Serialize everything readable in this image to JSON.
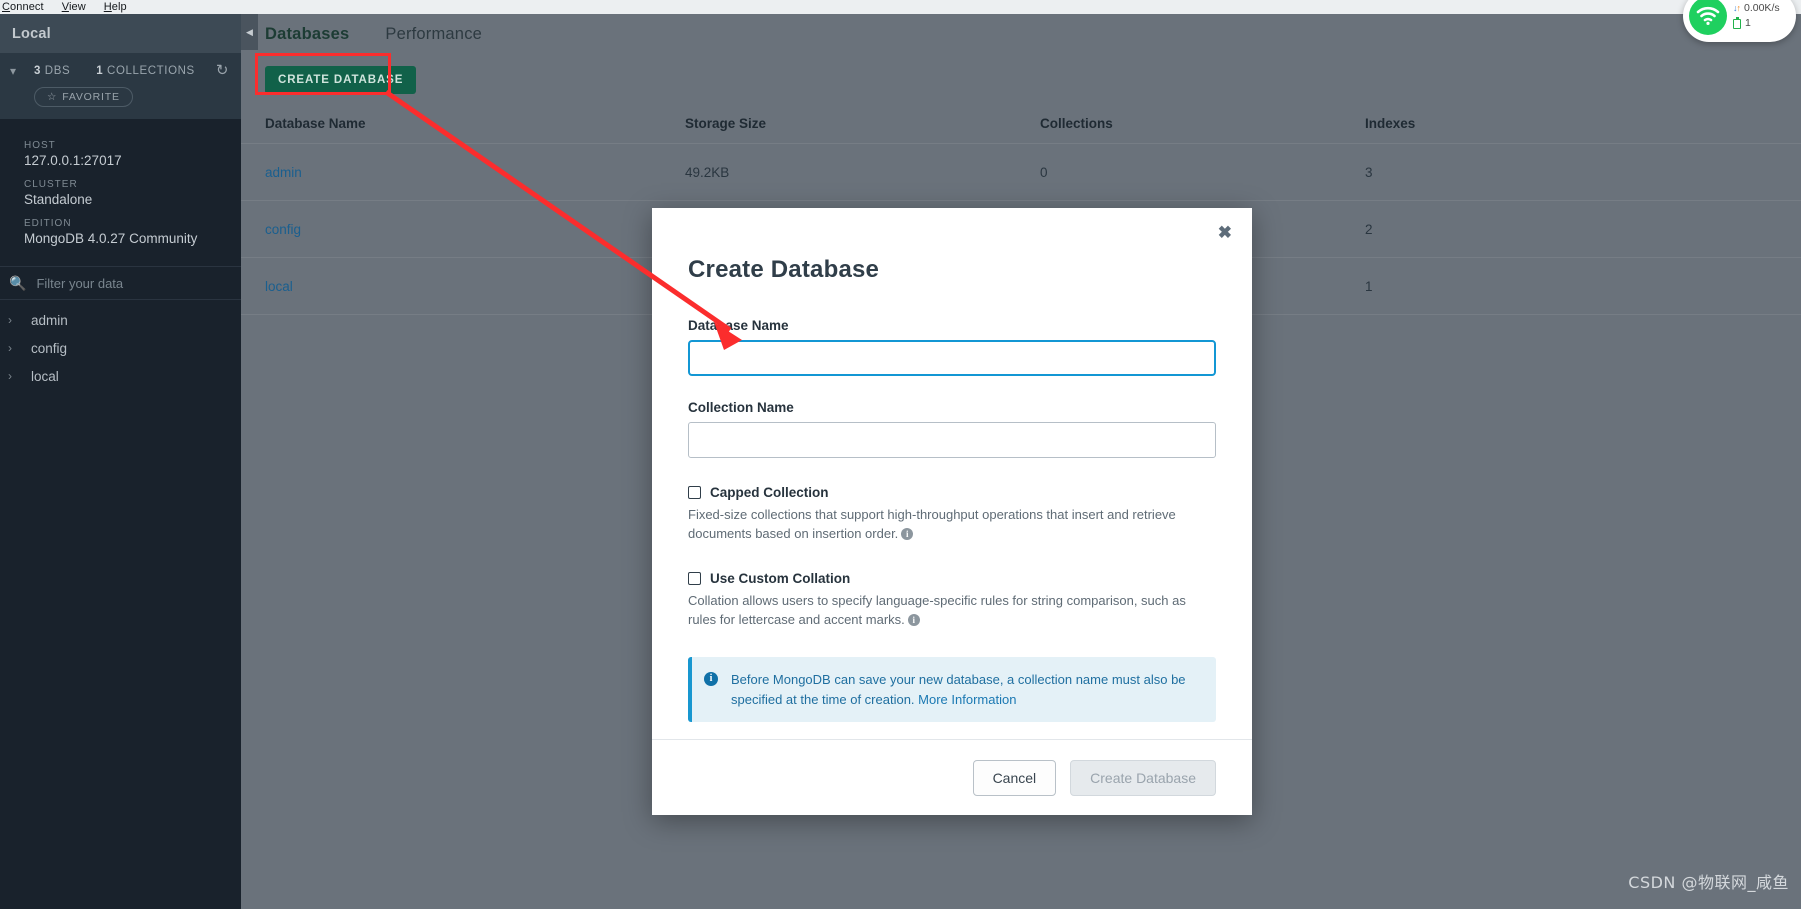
{
  "menubar": {
    "items": [
      {
        "label": "Connect",
        "accel": "C"
      },
      {
        "label": "View",
        "accel": "V"
      },
      {
        "label": "Help",
        "accel": "H"
      }
    ]
  },
  "sidebar": {
    "title": "Local",
    "stats": {
      "dbs_count": "3",
      "dbs_label": "DBS",
      "collections_count": "1",
      "collections_label": "COLLECTIONS"
    },
    "favorite_label": "FAVORITE",
    "info": [
      {
        "label": "HOST",
        "value": "127.0.0.1:27017"
      },
      {
        "label": "CLUSTER",
        "value": "Standalone"
      },
      {
        "label": "EDITION",
        "value": "MongoDB 4.0.27 Community"
      }
    ],
    "search": {
      "placeholder": "Filter your data",
      "value": ""
    },
    "tree": [
      {
        "label": "admin"
      },
      {
        "label": "config"
      },
      {
        "label": "local"
      }
    ]
  },
  "main": {
    "tabs": [
      {
        "label": "Databases",
        "active": true
      },
      {
        "label": "Performance",
        "active": false
      }
    ],
    "toolbar": {
      "create_database_label": "CREATE DATABASE"
    },
    "table": {
      "columns": [
        "Database Name",
        "Storage Size",
        "Collections",
        "Indexes"
      ],
      "rows": [
        {
          "name": "admin",
          "storage": "49.2KB",
          "collections": "0",
          "indexes": "3"
        },
        {
          "name": "config",
          "storage": "",
          "collections": "",
          "indexes": "2"
        },
        {
          "name": "local",
          "storage": "",
          "collections": "",
          "indexes": "1"
        }
      ]
    }
  },
  "modal": {
    "title": "Create Database",
    "close_label": "✖",
    "database_name": {
      "label": "Database Name",
      "value": "",
      "placeholder": ""
    },
    "collection_name": {
      "label": "Collection Name",
      "value": "",
      "placeholder": ""
    },
    "capped": {
      "label": "Capped Collection",
      "help": "Fixed-size collections that support high-throughput operations that insert and retrieve documents based on insertion order.",
      "checked": false
    },
    "collation": {
      "label": "Use Custom Collation",
      "help": "Collation allows users to specify language-specific rules for string comparison, such as rules for lettercase and accent marks.",
      "checked": false
    },
    "banner": {
      "text": "Before MongoDB can save your new database, a collection name must also be specified at the time of creation.",
      "link_label": "More Information"
    },
    "footer": {
      "cancel_label": "Cancel",
      "submit_label": "Create Database",
      "submit_disabled": true
    }
  },
  "network_widget": {
    "speed": "0.00K/s",
    "count": "1"
  },
  "watermark": "CSDN @物联网_咸鱼",
  "colors": {
    "accent_green": "#116149",
    "annotation_red": "#fb2d2d",
    "focus_blue": "#1397d4",
    "link_blue": "#1a5f8f",
    "sidebar_bg": "#19222c",
    "main_bg": "#6a727b"
  }
}
